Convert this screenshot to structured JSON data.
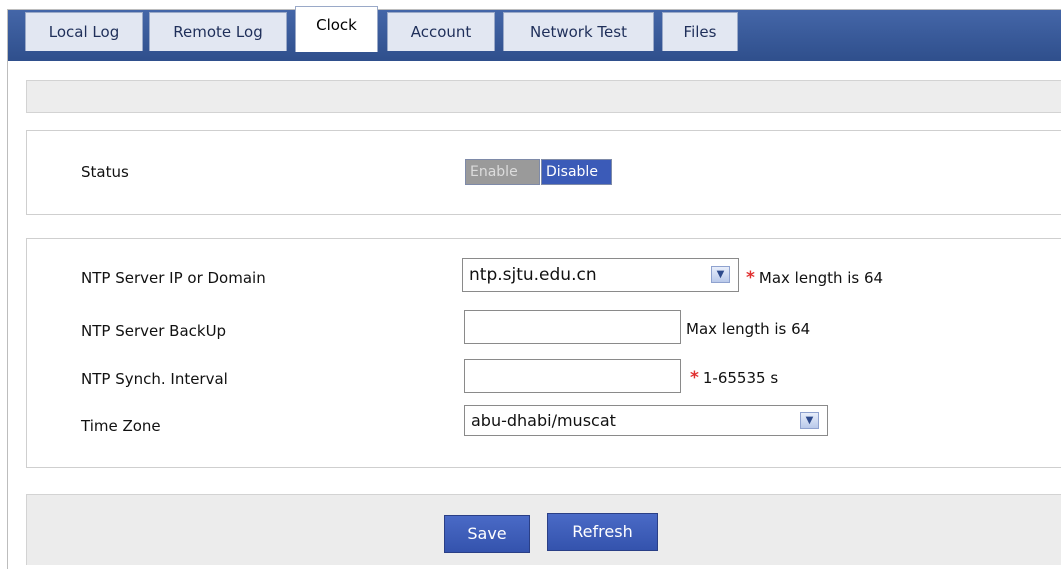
{
  "tabs": [
    {
      "label": "Local Log",
      "active": false
    },
    {
      "label": "Remote Log",
      "active": false
    },
    {
      "label": "Clock",
      "active": true
    },
    {
      "label": "Account",
      "active": false
    },
    {
      "label": "Network Test",
      "active": false
    },
    {
      "label": "Files",
      "active": false
    }
  ],
  "status": {
    "label": "Status",
    "enable_label": "Enable",
    "disable_label": "Disable",
    "selected": "Disable"
  },
  "ntp_server": {
    "label": "NTP Server IP or Domain",
    "value": "ntp.sjtu.edu.cn",
    "required_mark": "*",
    "hint": "Max length is 64"
  },
  "ntp_backup": {
    "label": "NTP Server BackUp",
    "value": "",
    "hint": "Max length is 64"
  },
  "ntp_interval": {
    "label": "NTP Synch. Interval",
    "value": "",
    "required_mark": "*",
    "hint": "1-65535 s"
  },
  "time_zone": {
    "label": "Time Zone",
    "value": "abu-dhabi/muscat"
  },
  "actions": {
    "save_label": "Save",
    "refresh_label": "Refresh"
  },
  "colors": {
    "tabbar": "#3a5b96",
    "primary_button": "#3a5ab8",
    "required": "#e03030"
  }
}
